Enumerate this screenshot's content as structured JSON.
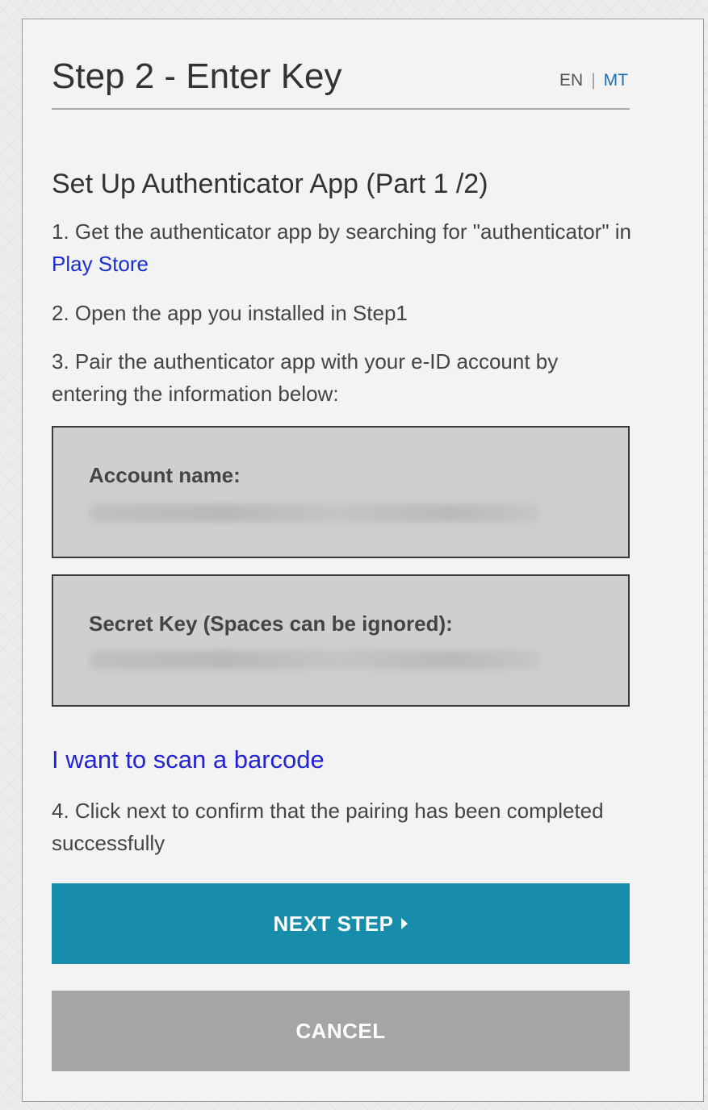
{
  "header": {
    "title": "Step 2 - Enter Key",
    "lang_en": "EN",
    "lang_sep": "|",
    "lang_mt": "MT"
  },
  "section": {
    "title": "Set Up Authenticator App (Part 1 /2)"
  },
  "steps": {
    "step1_text": "1. Get the authenticator app by searching for \"authenticator\" in ",
    "step1_link": "Play Store",
    "step2": "2. Open the app you installed in Step1",
    "step3": "3. Pair the authenticator app with your e-ID account by entering the information below:",
    "step4": "4. Click next to confirm that the pairing has been completed successfully"
  },
  "account_box": {
    "label": "Account name:"
  },
  "secret_box": {
    "label": "Secret Key (Spaces can be ignored):"
  },
  "barcode_link": "I want to scan a barcode",
  "buttons": {
    "next": "NEXT STEP",
    "cancel": "CANCEL"
  },
  "icons": {
    "next_icon": "caret-right-icon"
  },
  "colors": {
    "primary": "#178dab",
    "cancel": "#a5a5a5",
    "link": "#1a2fd1"
  }
}
